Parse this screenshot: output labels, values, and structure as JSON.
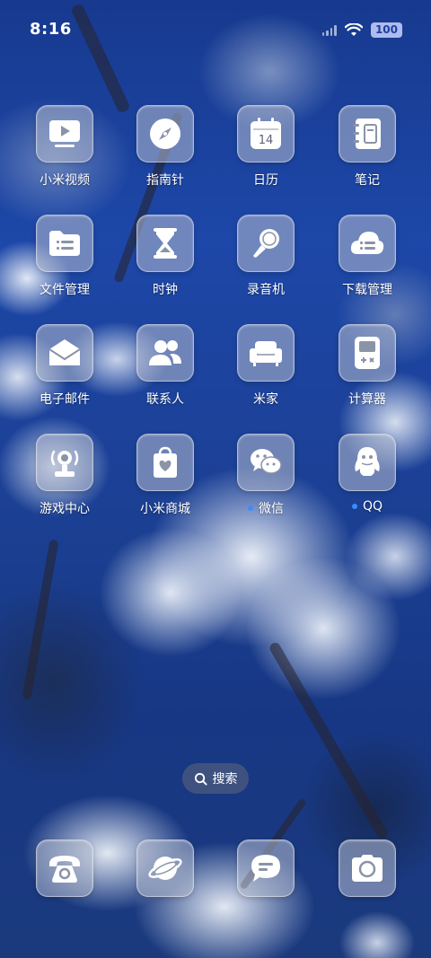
{
  "status_bar": {
    "time": "8:16",
    "battery": "100",
    "icons": [
      "signal-icon",
      "wifi-icon",
      "battery-icon"
    ]
  },
  "apps": [
    {
      "label": "小米视频",
      "icon": "video-icon"
    },
    {
      "label": "指南针",
      "icon": "compass-icon"
    },
    {
      "label": "日历",
      "icon": "calendar-icon",
      "date": "14"
    },
    {
      "label": "笔记",
      "icon": "notes-icon"
    },
    {
      "label": "文件管理",
      "icon": "folder-icon"
    },
    {
      "label": "时钟",
      "icon": "hourglass-icon"
    },
    {
      "label": "录音机",
      "icon": "microphone-icon"
    },
    {
      "label": "下载管理",
      "icon": "download-cloud-icon"
    },
    {
      "label": "电子邮件",
      "icon": "mail-icon"
    },
    {
      "label": "联系人",
      "icon": "contacts-icon"
    },
    {
      "label": "米家",
      "icon": "sofa-icon"
    },
    {
      "label": "计算器",
      "icon": "calculator-icon"
    },
    {
      "label": "游戏中心",
      "icon": "game-center-icon"
    },
    {
      "label": "小米商城",
      "icon": "shopping-bag-icon"
    },
    {
      "label": "微信",
      "icon": "wechat-icon",
      "new_dot": true
    },
    {
      "label": "QQ",
      "icon": "qq-penguin-icon",
      "new_dot": true
    }
  ],
  "search": {
    "label": "搜索",
    "icon": "search-icon"
  },
  "dock": [
    {
      "icon": "phone-icon"
    },
    {
      "icon": "browser-planet-icon"
    },
    {
      "icon": "messages-icon"
    },
    {
      "icon": "camera-icon"
    }
  ],
  "colors": {
    "notification_dot": "#3b8cff",
    "icon_tile": "#b4bccd"
  }
}
